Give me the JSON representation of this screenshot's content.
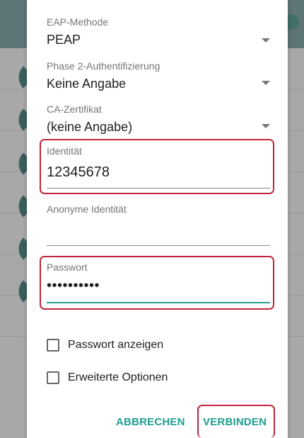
{
  "dialog": {
    "eap_method": {
      "label": "EAP-Methode",
      "value": "PEAP"
    },
    "phase2_auth": {
      "label": "Phase 2-Authentifizierung",
      "value": "Keine Angabe"
    },
    "ca_certificate": {
      "label": "CA-Zertifikat",
      "value": "(keine Angabe)"
    },
    "identity": {
      "label": "Identität",
      "value": "12345678"
    },
    "anonymous_identity": {
      "label": "Anonyme Identität",
      "value": ""
    },
    "password": {
      "label": "Passwort",
      "value_masked": "••••••••••"
    },
    "show_password": {
      "label": "Passwort anzeigen",
      "checked": false
    },
    "advanced_options": {
      "label": "Erweiterte Optionen",
      "checked": false
    },
    "cancel_label": "ABBRECHEN",
    "connect_label": "VERBINDEN"
  },
  "colors": {
    "accent": "#1e9e90",
    "highlight_border": "#c0273a"
  }
}
